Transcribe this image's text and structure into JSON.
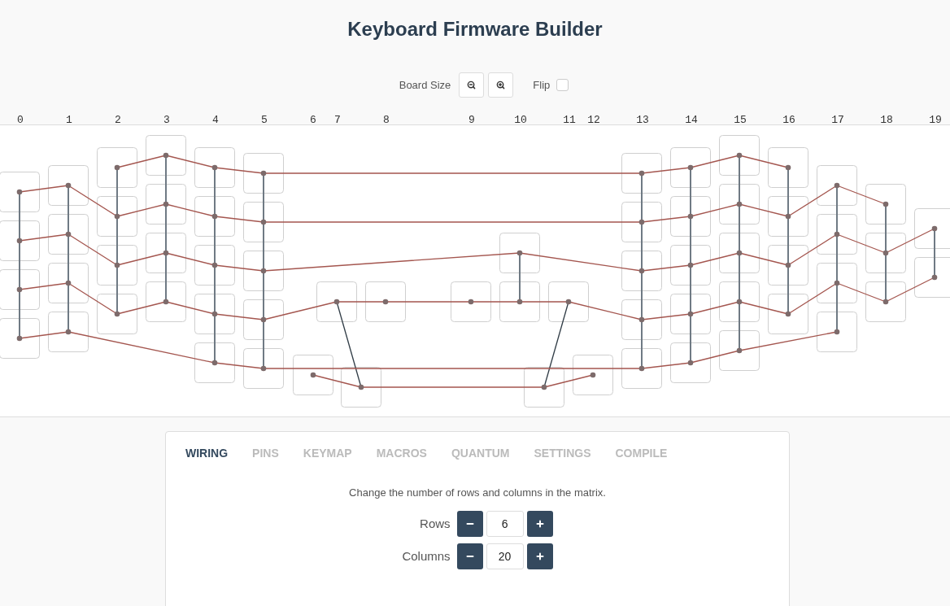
{
  "title": "Keyboard Firmware Builder",
  "board_controls": {
    "board_size_label": "Board Size",
    "flip": {
      "label": "Flip",
      "checked": false
    }
  },
  "column_numbers": [
    "0",
    "1",
    "2",
    "3",
    "4",
    "5",
    "6",
    "7",
    "8",
    "9",
    "10",
    "11",
    "12",
    "13",
    "14",
    "15",
    "16",
    "17",
    "18",
    "19"
  ],
  "tabs": [
    {
      "label": "WIRING",
      "selected": true
    },
    {
      "label": "PINS",
      "selected": false
    },
    {
      "label": "KEYMAP",
      "selected": false
    },
    {
      "label": "MACROS",
      "selected": false
    },
    {
      "label": "QUANTUM",
      "selected": false
    },
    {
      "label": "SETTINGS",
      "selected": false
    },
    {
      "label": "COMPILE",
      "selected": false
    }
  ],
  "wiring": {
    "description": "Change the number of rows and columns in the matrix.",
    "fields": [
      {
        "label": "Rows",
        "value": "6"
      },
      {
        "label": "Columns",
        "value": "20"
      }
    ]
  }
}
